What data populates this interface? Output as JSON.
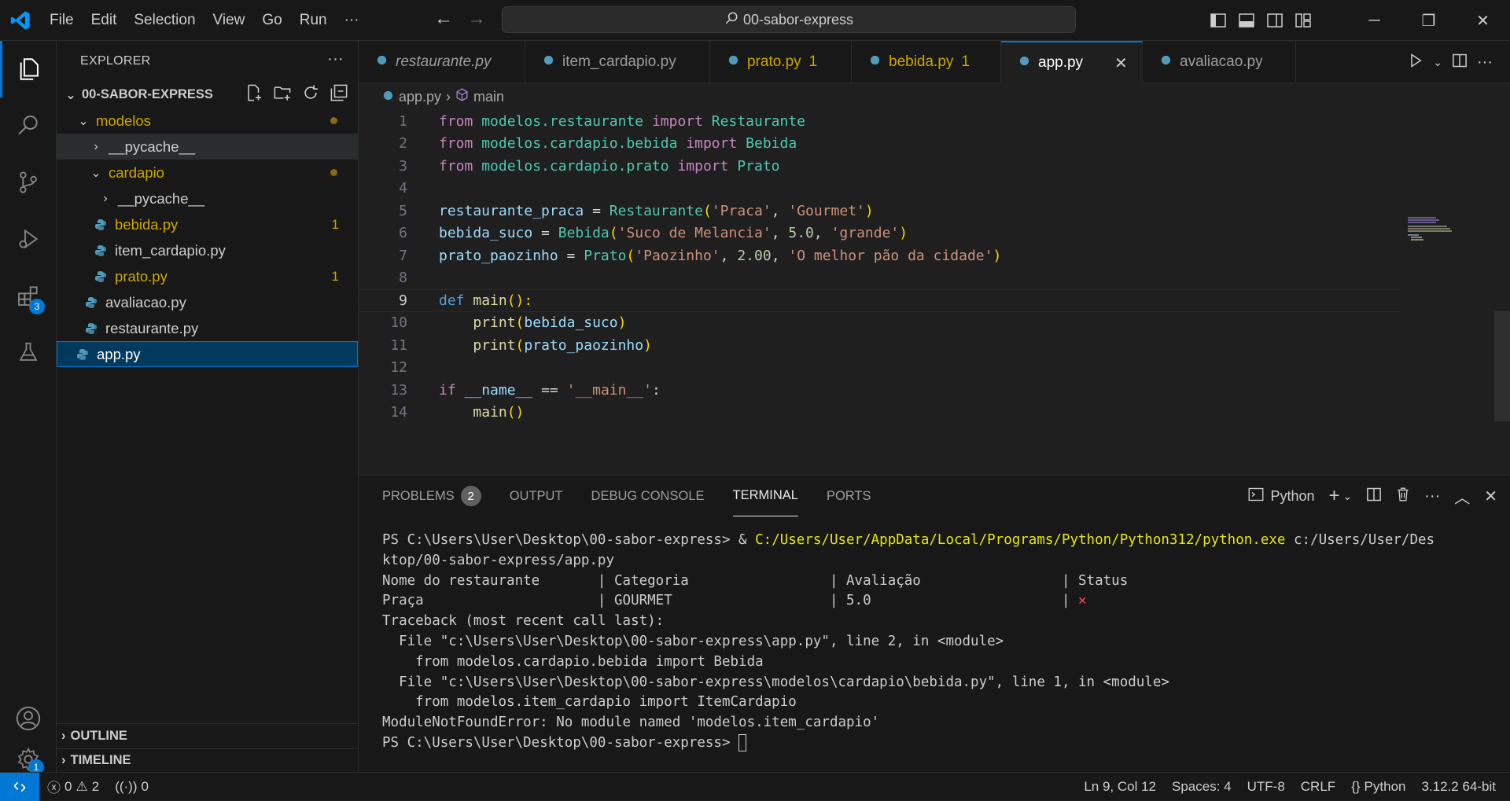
{
  "titlebar": {
    "menu": [
      "File",
      "Edit",
      "Selection",
      "View",
      "Go",
      "Run",
      "···"
    ],
    "search": "00-sabor-express"
  },
  "activitybar": {
    "extensions_badge": "3",
    "settings_badge": "1"
  },
  "sidebar": {
    "title": "EXPLORER",
    "more": "···",
    "root": "00-SABOR-EXPRESS",
    "tree": [
      {
        "label": "modelos"
      },
      {
        "label": "__pycache__"
      },
      {
        "label": "cardapio"
      },
      {
        "label": "__pycache__"
      },
      {
        "label": "bebida.py",
        "count": "1"
      },
      {
        "label": "item_cardapio.py"
      },
      {
        "label": "prato.py",
        "count": "1"
      },
      {
        "label": "avaliacao.py"
      },
      {
        "label": "restaurante.py"
      },
      {
        "label": "app.py"
      }
    ],
    "outline": "OUTLINE",
    "timeline": "TIMELINE"
  },
  "tabs": [
    {
      "label": "restaurante.py"
    },
    {
      "label": "item_cardapio.py"
    },
    {
      "label": "prato.py",
      "count": "1"
    },
    {
      "label": "bebida.py",
      "count": "1"
    },
    {
      "label": "app.py"
    },
    {
      "label": "avaliacao.py"
    }
  ],
  "breadcrumb": {
    "file": "app.py",
    "symbol": "main"
  },
  "code": {
    "line_numbers": [
      "1",
      "2",
      "3",
      "4",
      "5",
      "6",
      "7",
      "8",
      "9",
      "10",
      "11",
      "12",
      "13",
      "14"
    ],
    "l1": [
      "from",
      " modelos.restaurante ",
      "import",
      " Restaurante"
    ],
    "l2": [
      "from",
      " modelos.cardapio.bebida ",
      "import",
      " Bebida"
    ],
    "l3": [
      "from",
      " modelos.cardapio.prato ",
      "import",
      " Prato"
    ],
    "l5": [
      "restaurante_praca",
      " = ",
      "Restaurante",
      "(",
      "'Praca'",
      ", ",
      "'Gourmet'",
      ")"
    ],
    "l6": [
      "bebida_suco",
      " = ",
      "Bebida",
      "(",
      "'Suco de Melancia'",
      ", ",
      "5.0",
      ", ",
      "'grande'",
      ")"
    ],
    "l7": [
      "prato_paozinho",
      " = ",
      "Prato",
      "(",
      "'Paozinho'",
      ", ",
      "2.00",
      ", ",
      "'O melhor pão da cidade'",
      ")"
    ],
    "l9": [
      "def",
      " ",
      "main",
      "():",
      ""
    ],
    "l10": [
      "    ",
      "print",
      "(",
      "bebida_suco",
      ")"
    ],
    "l11": [
      "    ",
      "print",
      "(",
      "prato_paozinho",
      ")"
    ],
    "l13": [
      "if",
      " ",
      "__name__",
      " == ",
      "'__main__'",
      ":"
    ],
    "l14": [
      "    ",
      "main",
      "()"
    ]
  },
  "panel": {
    "tabs": [
      "PROBLEMS",
      "OUTPUT",
      "DEBUG CONSOLE",
      "TERMINAL",
      "PORTS"
    ],
    "problems_count": "2",
    "shell": "Python",
    "terminal": {
      "line1_prompt": "PS C:\\Users\\User\\Desktop\\00-sabor-express> & ",
      "line1_exe": "C:/Users/User/AppData/Local/Programs/Python/Python312/python.exe",
      "line1_rest": " c:/Users/User/Des",
      "line2": "ktop/00-sabor-express/app.py",
      "line3": "Nome do restaurante       | Categoria                 | Avaliação                 | Status",
      "line4": "Praça                     | GOURMET                   | 5.0                       | ",
      "line4_status": "✕",
      "line5": "Traceback (most recent call last):",
      "line6": "  File \"c:\\Users\\User\\Desktop\\00-sabor-express\\app.py\", line 2, in <module>",
      "line7": "    from modelos.cardapio.bebida import Bebida",
      "line8": "  File \"c:\\Users\\User\\Desktop\\00-sabor-express\\modelos\\cardapio\\bebida.py\", line 1, in <module>",
      "line9": "    from modelos.item_cardapio import ItemCardapio",
      "line10": "ModuleNotFoundError: No module named 'modelos.item_cardapio'",
      "line11": "PS C:\\Users\\User\\Desktop\\00-sabor-express> "
    }
  },
  "statusbar": {
    "errors": "0",
    "warnings": "2",
    "ports": "0",
    "position": "Ln 9, Col 12",
    "spaces": "Spaces: 4",
    "encoding": "UTF-8",
    "eol": "CRLF",
    "language": "Python",
    "interpreter": "3.12.2 64-bit"
  },
  "colors": {
    "accent": "#0078d4",
    "modified": "#cca700",
    "error": "#f14c4c"
  }
}
